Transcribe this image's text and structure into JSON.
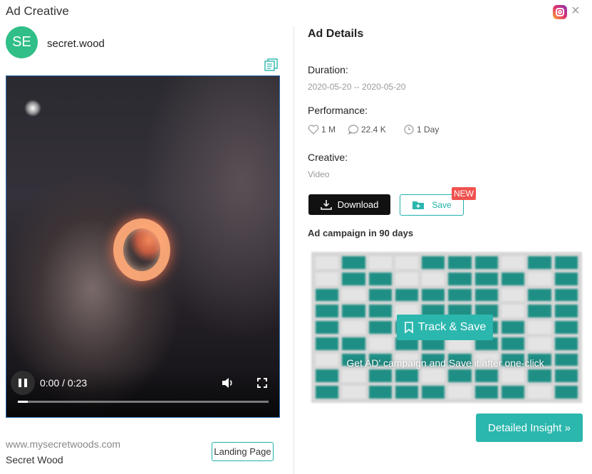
{
  "header": {
    "title": "Ad Creative",
    "close_label": "×"
  },
  "account": {
    "initials": "SE",
    "name": "secret.wood"
  },
  "video": {
    "time": "0:00 / 0:23",
    "progress": 0.04
  },
  "footer": {
    "url": "www.mysecretwoods.com",
    "brand": "Secret Wood",
    "landing_label": "Landing Page"
  },
  "details": {
    "title": "Ad Details",
    "duration_label": "Duration:",
    "duration_value": "2020-05-20 -- 2020-05-20",
    "performance_label": "Performance:",
    "likes": "1 M",
    "comments": "22.4 K",
    "days": "1 Day",
    "creative_label": "Creative:",
    "creative_value": "Video",
    "download_label": "Download",
    "save_label": "Save",
    "new_badge": "NEW",
    "campaign_title": "Ad campaign in 90 days",
    "track_label": "Track & Save",
    "overlay_text": "Get AD' campaign and Save it after one-click",
    "insight_label": "Detailed Insight »"
  },
  "colors": {
    "accent": "#2bb7ae",
    "avatar": "#2fbf87",
    "badge": "#f0524f"
  },
  "icons": [
    "instagram-icon",
    "close-icon",
    "copy-icon",
    "pause-icon",
    "volume-icon",
    "fullscreen-icon",
    "heart-icon",
    "comment-icon",
    "clock-icon",
    "download-icon",
    "folder-plus-icon",
    "bookmark-icon"
  ]
}
